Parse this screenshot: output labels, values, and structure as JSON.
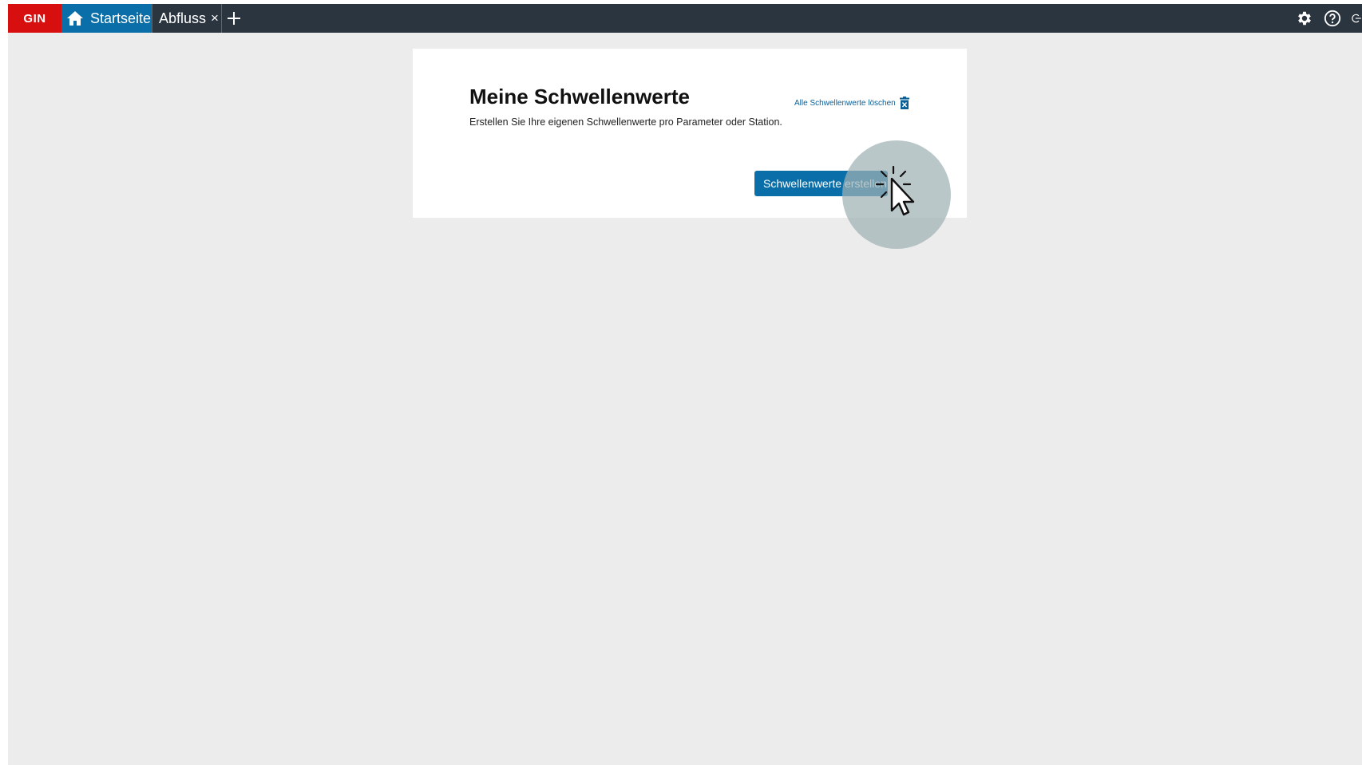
{
  "topbar": {
    "brand": "GIN",
    "tabs": [
      {
        "label": "Startseite",
        "icon": "home-icon"
      },
      {
        "label": "Abfluss",
        "close": "×"
      }
    ],
    "add_tab_icon": "plus-icon",
    "right_icons": [
      "gear-icon",
      "help-icon",
      "logout-icon"
    ],
    "colors": {
      "bar": "#2b3540",
      "brand": "#d80f0f",
      "active_tab": "#0a6ea8"
    }
  },
  "card": {
    "title": "Meine Schwellenwerte",
    "subtitle": "Erstellen Sie Ihre eigenen Schwellenwerte pro Parameter oder Station.",
    "delete_all_label": "Alle Schwellenwerte löschen",
    "delete_icon": "trash-icon",
    "create_button_label": "Schwellenwerte erstellen"
  },
  "cursor": {
    "icon": "click-cursor-icon"
  }
}
